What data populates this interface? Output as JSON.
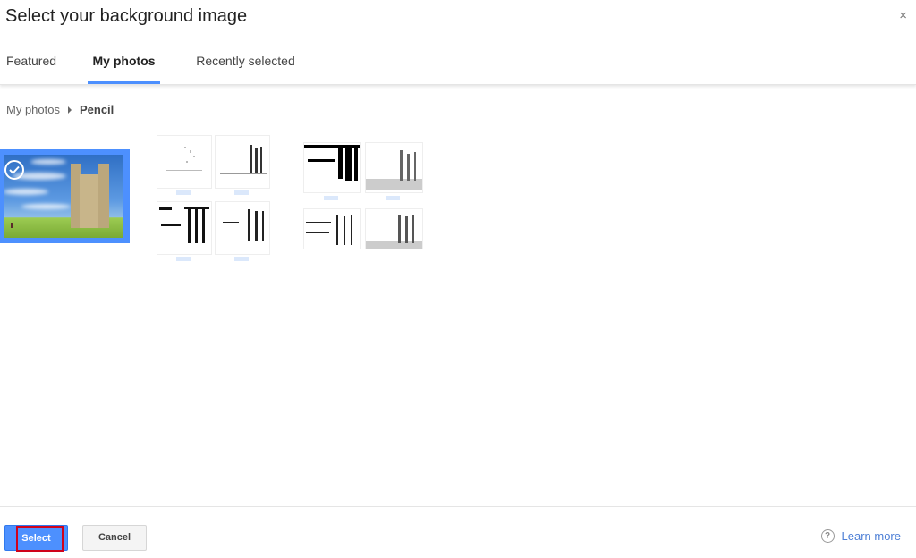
{
  "dialog": {
    "title": "Select your background image",
    "close_icon": "×"
  },
  "tabs": [
    {
      "label": "Featured",
      "active": false
    },
    {
      "label": "My photos",
      "active": true
    },
    {
      "label": "Recently selected",
      "active": false
    }
  ],
  "breadcrumb": {
    "parent": "My photos",
    "current": "Pencil"
  },
  "photos": {
    "selected": {
      "description": "castle tower under blue sky",
      "selected": true
    },
    "pencil_variants_group_1": 4,
    "pencil_variants_group_2": 4
  },
  "footer": {
    "select_label": "Select",
    "cancel_label": "Cancel",
    "help_icon": "?",
    "learn_more_label": "Learn more"
  },
  "colors": {
    "accent": "#4d90fe",
    "highlight": "#d0021b",
    "link": "#4d7fd6"
  }
}
